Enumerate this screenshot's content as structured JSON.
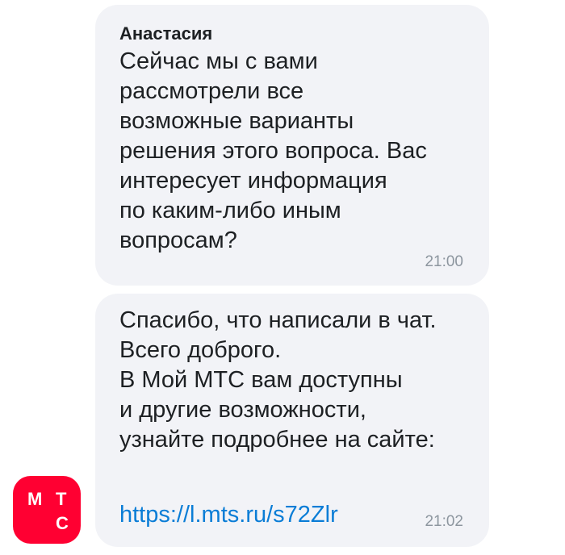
{
  "messages": [
    {
      "sender": "Анастасия",
      "text": "Сейчас мы с вами\nрассмотрели все\nвозможные варианты\nрешения этого вопроса. Вас\nинтересует информация\nпо каким-либо иным\nвопросам?",
      "time": "21:00"
    },
    {
      "text": "Спасибо, что написали в чат.\nВсего доброго.\nВ Мой МТС вам доступны\nи другие возможности,\nузнайте подробнее на сайте:",
      "link": "https://l.mts.ru/s72Zlr",
      "time": "21:02"
    }
  ],
  "avatar": {
    "letters": [
      "М",
      "Т",
      "С"
    ],
    "color": "#ff0032",
    "icon": "mts-logo-icon"
  }
}
